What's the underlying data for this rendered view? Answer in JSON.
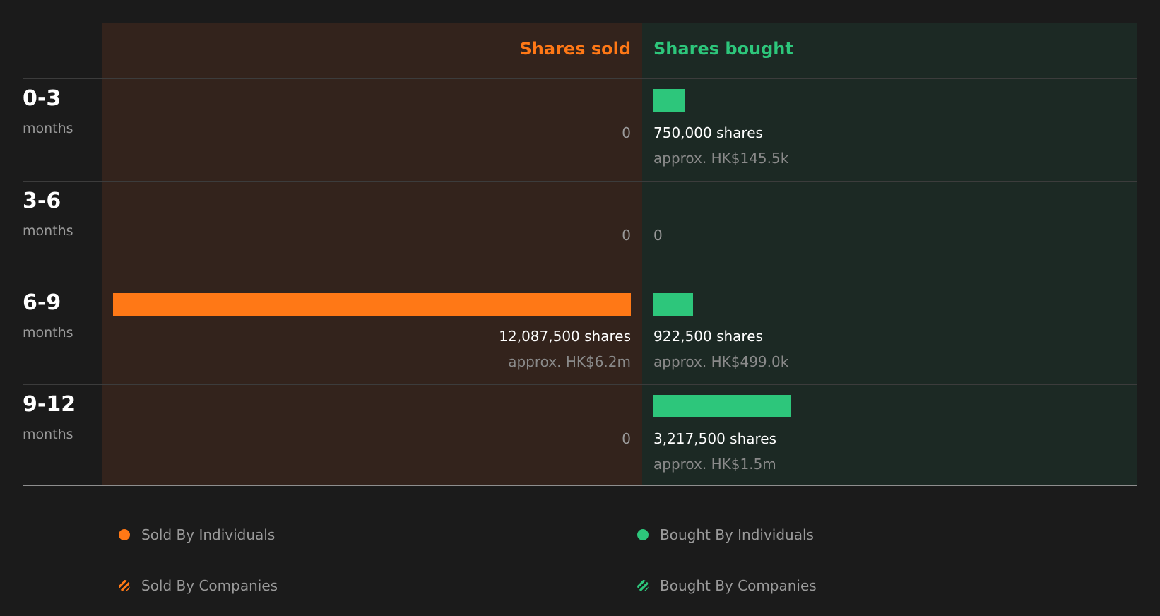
{
  "chart_data": {
    "type": "bar",
    "headers": {
      "sold": "Shares sold",
      "bought": "Shares bought"
    },
    "unit_label": "months",
    "colors": {
      "sold": "#ff7816",
      "bought": "#2dc67b"
    },
    "max_shares": 12087500,
    "rows": [
      {
        "period": "0-3",
        "sold": 0,
        "sold_label": "0",
        "sold_approx": "",
        "bought": 750000,
        "bought_label": "750,000 shares",
        "bought_approx": "approx. HK$145.5k"
      },
      {
        "period": "3-6",
        "sold": 0,
        "sold_label": "0",
        "sold_approx": "",
        "bought": 0,
        "bought_label": "0",
        "bought_approx": ""
      },
      {
        "period": "6-9",
        "sold": 12087500,
        "sold_label": "12,087,500 shares",
        "sold_approx": "approx. HK$6.2m",
        "bought": 922500,
        "bought_label": "922,500 shares",
        "bought_approx": "approx. HK$499.0k"
      },
      {
        "period": "9-12",
        "sold": 0,
        "sold_label": "0",
        "sold_approx": "",
        "bought": 3217500,
        "bought_label": "3,217,500 shares",
        "bought_approx": "approx. HK$1.5m"
      }
    ],
    "legend": [
      {
        "label": "Sold By Individuals",
        "kind": "sold-individuals"
      },
      {
        "label": "Bought By Individuals",
        "kind": "bought-individuals"
      },
      {
        "label": "Sold By Companies",
        "kind": "sold-companies"
      },
      {
        "label": "Bought By Companies",
        "kind": "bought-companies"
      }
    ]
  }
}
